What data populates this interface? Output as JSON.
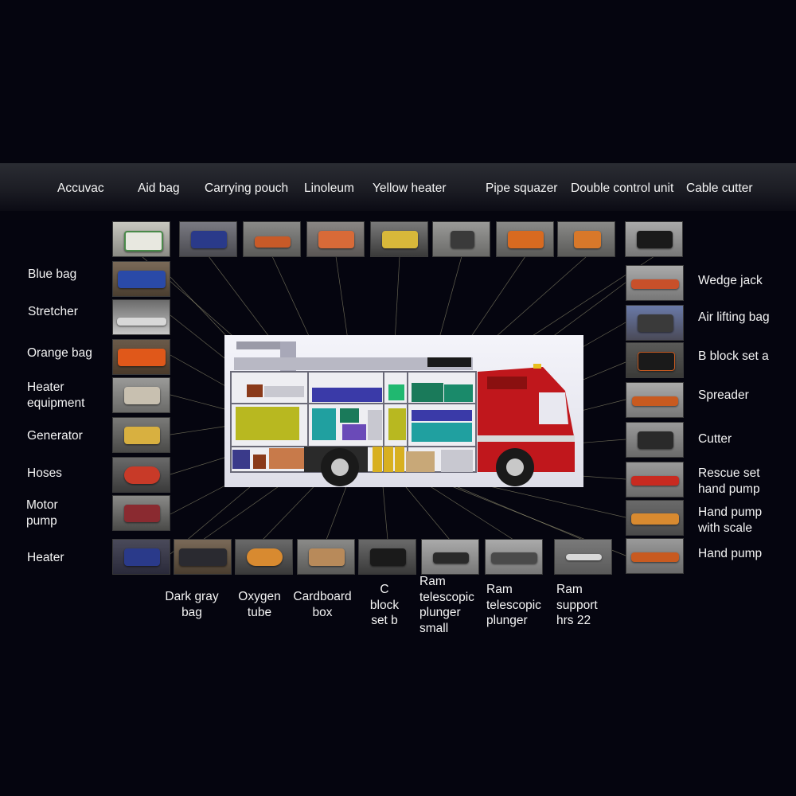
{
  "labels": {
    "accuvac": "Accuvac",
    "aid_bag": "Aid bag",
    "carrying_pouch": "Carrying pouch",
    "linoleum": "Linoleum",
    "yellow_heater": "Yellow heater",
    "pipe_squazer": "Pipe squazer",
    "double_control_unit": "Double control unit",
    "cable_cutter": "Cable cutter",
    "blue_bag": "Blue bag",
    "stretcher": "Stretcher",
    "orange_bag": "Orange bag",
    "heater_equipment": "Heater\nequipment",
    "generator": "Generator",
    "hoses": "Hoses",
    "motor_pump": "Motor\npump",
    "heater": "Heater",
    "wedge_jack": "Wedge jack",
    "air_lifting_bag": "Air lifting bag",
    "b_block_set_a": "B block set a",
    "spreader": "Spreader",
    "cutter": "Cutter",
    "rescue_set_hand_pump": "Rescue set\nhand pump",
    "hand_pump_with_scale": "Hand pump\nwith scale",
    "hand_pump": "Hand pump",
    "dark_gray_bag": "Dark gray\nbag",
    "oxygen_tube": "Oxygen\ntube",
    "cardboard_box": "Cardboard\nbox",
    "c_block_set_b": "C\nblock\nset b",
    "ram_telescopic_plunger_small": "Ram\ntelescopic\nplunger\nsmall",
    "ram_telescopic_plunger": "Ram\ntelescopic\nplunger",
    "ram_support_hrs_22": "Ram\nsupport\nhrs 22"
  },
  "colors": {
    "background": "#05050f",
    "truck_cab": "#c0171c",
    "leader_line": "#d8d2a0"
  }
}
